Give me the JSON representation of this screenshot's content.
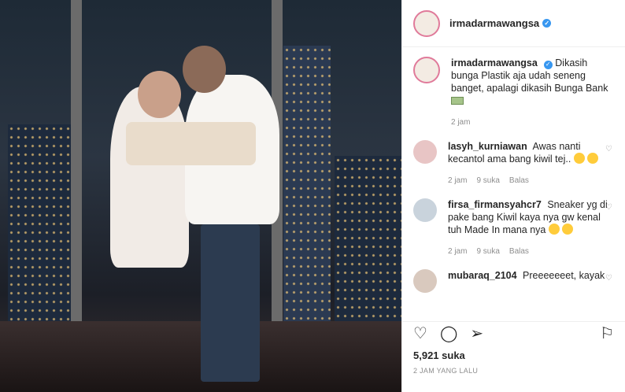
{
  "post": {
    "username": "irmadarmawangsa",
    "verified_icon": "verified-badge-icon",
    "image_alt": "couple-photo"
  },
  "caption": {
    "username": "irmadarmawangsa",
    "text": "Dikasih bunga Plastik aja udah seneng banget, apalagi dikasih Bunga Bank",
    "emoji": "money-icon",
    "time": "2 jam"
  },
  "comments": [
    {
      "username": "lasyh_kurniawan",
      "text": "Awas nanti kecantol ama bang kiwil tej..",
      "time": "2 jam",
      "likes": "9 suka",
      "reply": "Balas"
    },
    {
      "username": "firsa_firmansyahcr7",
      "text": "Sneaker yg di pake bang Kiwil kaya nya gw kenal tuh Made In mana nya",
      "time": "2 jam",
      "likes": "9 suka",
      "reply": "Balas"
    },
    {
      "username": "mubaraq_2104",
      "text": "Preeeeeeet, kayak"
    }
  ],
  "footer": {
    "likes": "5,921 suka",
    "posted": "2 JAM YANG LALU"
  },
  "icons": {
    "like": "heart-icon",
    "comment": "comment-icon",
    "share": "share-icon",
    "save": "bookmark-icon"
  },
  "colors": {
    "verified": "#3897f0",
    "muted": "#8e8e8e",
    "text": "#262626"
  }
}
